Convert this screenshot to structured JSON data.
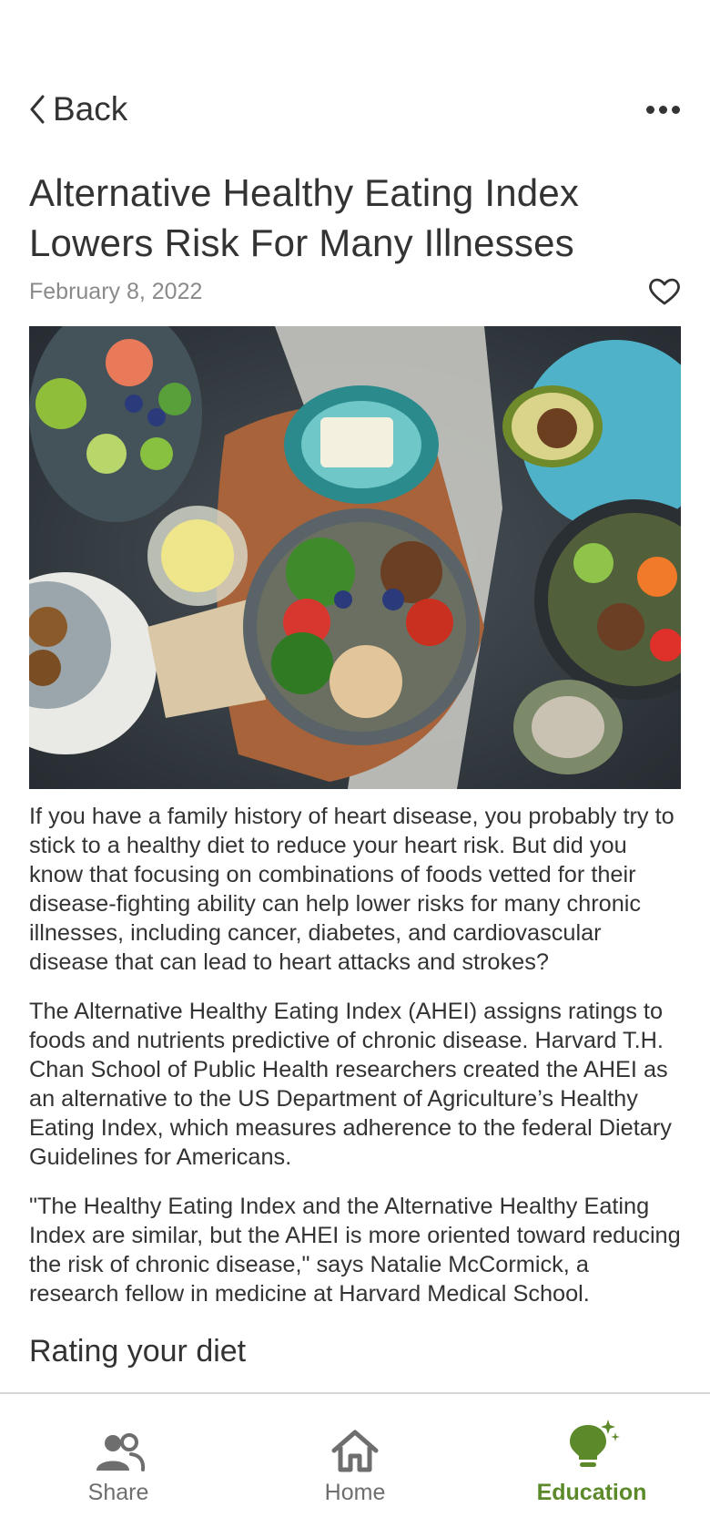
{
  "header": {
    "back_label": "Back"
  },
  "article": {
    "title": "Alternative Healthy Eating Index Lowers Risk For Many Illnesses",
    "date": "February 8, 2022",
    "paragraphs": [
      "If you have a family history of heart disease, you probably try to stick to a healthy diet to reduce your heart risk. But did you know that focusing on combinations of foods vetted for their disease-fighting ability can help lower risks for many chronic illnesses, including cancer, diabetes, and cardiovascular disease that can lead to heart attacks and strokes?",
      "The Alternative Healthy Eating Index (AHEI) assigns ratings to foods and nutrients predictive of chronic disease. Harvard T.H. Chan School of Public Health researchers created the AHEI as an alternative to the US Department of Agriculture’s Healthy Eating Index, which measures adherence to the federal Dietary Guidelines for Americans.",
      "\"The Healthy Eating Index and the Alternative Healthy Eating Index are similar, but the AHEI is more oriented toward reducing the risk of chronic disease,\" says Natalie McCormick, a research fellow in medicine at Harvard Medical School."
    ],
    "section_heading": "Rating your diet"
  },
  "tabs": [
    {
      "label": "Share",
      "icon": "people-icon",
      "active": false
    },
    {
      "label": "Home",
      "icon": "home-icon",
      "active": false
    },
    {
      "label": "Education",
      "icon": "lightbulb-sparkle-icon",
      "active": true
    }
  ],
  "colors": {
    "accent": "#5c8a2a",
    "text": "#333333",
    "muted": "#8a8a8a",
    "tab_inactive": "#6e6e6e"
  }
}
